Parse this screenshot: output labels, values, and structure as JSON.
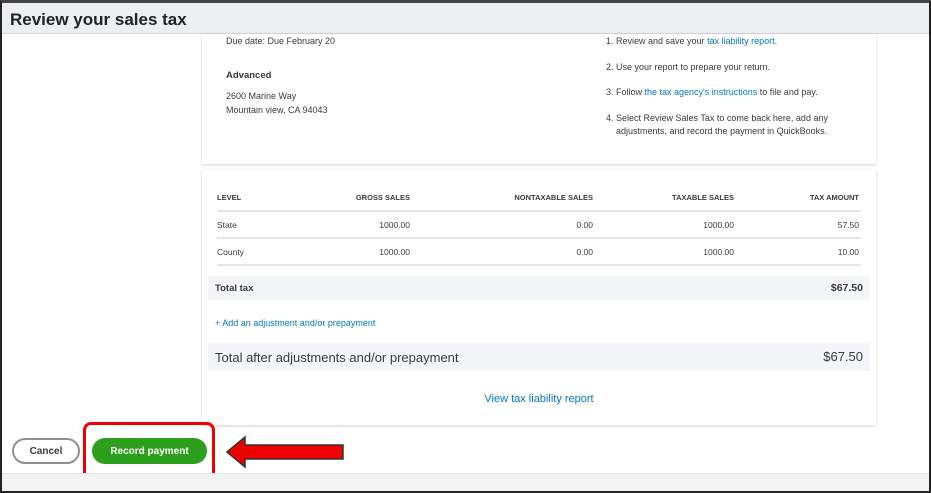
{
  "title": "Review your sales tax",
  "due": "Due date:  Due February 20",
  "agency": {
    "name": "Advanced",
    "address1": "2600 Marine Way",
    "address2": "Mountain view, CA 94043"
  },
  "steps": {
    "s1_pre": "1. Review and save your ",
    "s1_link": "tax liability report",
    "s1_post": ".",
    "s2": "2. Use your report to prepare your return.",
    "s3_pre": "3. Follow ",
    "s3_link": "the tax agency's instructions",
    "s3_post": " to file and pay.",
    "s4a": "4. Select Review Sales Tax to come back here, add any",
    "s4b": "adjustments, and record the payment in QuickBooks."
  },
  "table": {
    "headers": [
      "LEVEL",
      "GROSS SALES",
      "NONTAXABLE SALES",
      "TAXABLE SALES",
      "TAX AMOUNT"
    ],
    "rows": [
      [
        "State",
        "1000.00",
        "0.00",
        "1000.00",
        "57.50"
      ],
      [
        "County",
        "1000.00",
        "0.00",
        "1000.00",
        "10.00"
      ]
    ]
  },
  "total_tax": {
    "label": "Total tax",
    "value": "$67.50"
  },
  "add_adjustment": "+ Add an adjustment and/or prepayment",
  "total_after": {
    "label": "Total after adjustments and/or prepayment",
    "value": "$67.50"
  },
  "view_report": "View tax liability report",
  "buttons": {
    "cancel": "Cancel",
    "record": "Record payment"
  }
}
